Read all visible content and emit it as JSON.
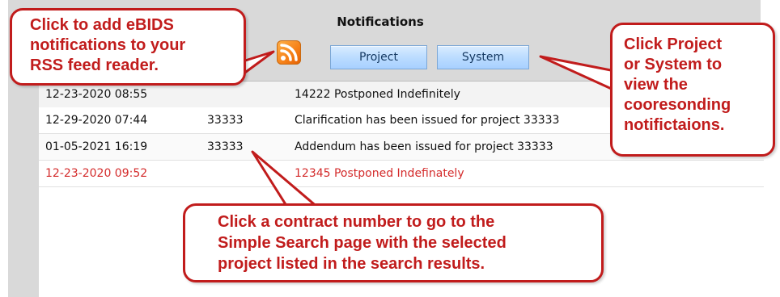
{
  "panel": {
    "title": "Notifications",
    "tabs": [
      {
        "label": "Project"
      },
      {
        "label": "System"
      }
    ]
  },
  "rows": [
    {
      "date": "12-23-2020 08:55",
      "project": "",
      "message": "14222 Postponed Indefinitely",
      "highlight": false
    },
    {
      "date": "12-29-2020 07:44",
      "project": "33333",
      "message": "Clarification has been issued for project 33333",
      "highlight": false
    },
    {
      "date": "01-05-2021 16:19",
      "project": "33333",
      "message": "Addendum has been issued for project 33333",
      "highlight": false
    },
    {
      "date": "12-23-2020 09:52",
      "project": "",
      "message": "12345 Postponed Indefinately",
      "highlight": true
    }
  ],
  "callouts": {
    "rss": {
      "lines": [
        "Click to add eBIDS",
        "notifications to your",
        "RSS feed reader."
      ]
    },
    "tabs": {
      "lines": [
        "Click Project",
        "or System to",
        "view the",
        "cooresonding",
        "notifictaions."
      ]
    },
    "contract": {
      "lines": [
        "Click a contract number to go to the",
        "Simple Search page with the selected",
        "project listed in the search results."
      ]
    }
  },
  "icons": {
    "rss": "rss-feed-icon"
  },
  "colors": {
    "callout_red": "#c11c1c",
    "row_red": "#d42b2b",
    "tab_blue": "#b9dbff"
  }
}
